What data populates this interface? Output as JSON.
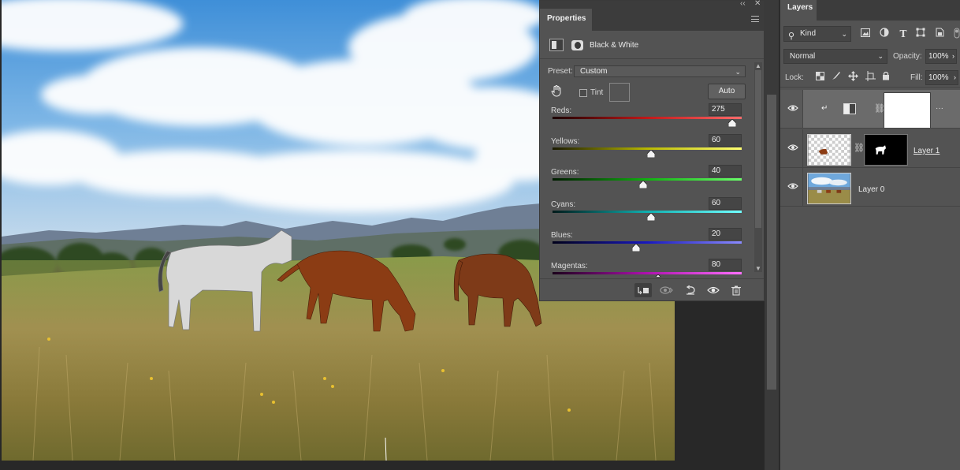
{
  "properties": {
    "tab": "Properties",
    "collapse_glyph": "‹‹",
    "close_glyph": "✕",
    "adjustment_name": "Black & White",
    "preset_label": "Preset:",
    "preset_value": "Custom",
    "tint_label": "Tint",
    "tint_checked": false,
    "auto_label": "Auto",
    "sliders": [
      {
        "name": "Reds:",
        "value": "275",
        "position": 0.95,
        "gradient": [
          "#1a0000",
          "#c01818",
          "#ff6a6a"
        ]
      },
      {
        "name": "Yellows:",
        "value": "60",
        "position": 0.52,
        "gradient": [
          "#1a1a00",
          "#b8b800",
          "#ffff70"
        ]
      },
      {
        "name": "Greens:",
        "value": "40",
        "position": 0.48,
        "gradient": [
          "#001a00",
          "#10b010",
          "#6aff6a"
        ]
      },
      {
        "name": "Cyans:",
        "value": "60",
        "position": 0.52,
        "gradient": [
          "#001a1a",
          "#10b0b0",
          "#70ffff"
        ]
      },
      {
        "name": "Blues:",
        "value": "20",
        "position": 0.44,
        "gradient": [
          "#00001a",
          "#1818c0",
          "#8a8aff"
        ]
      },
      {
        "name": "Magentas:",
        "value": "80",
        "position": 0.56,
        "gradient": [
          "#1a001a",
          "#b010b0",
          "#ff70ff"
        ]
      }
    ],
    "bottom_icons": [
      "clip-to-layer-icon",
      "view-previous-icon",
      "reset-icon",
      "visibility-icon",
      "trash-icon"
    ]
  },
  "layers": {
    "tab": "Layers",
    "kind_label": "Kind",
    "blend_mode": "Normal",
    "opacity_label": "Opacity:",
    "opacity_value": "100%",
    "lock_label": "Lock:",
    "fill_label": "Fill:",
    "fill_value": "100%",
    "items": [
      {
        "name": "",
        "type": "adjustment",
        "selected": true
      },
      {
        "name": "Layer 1",
        "type": "masked"
      },
      {
        "name": "Layer 0",
        "type": "photo"
      }
    ]
  }
}
